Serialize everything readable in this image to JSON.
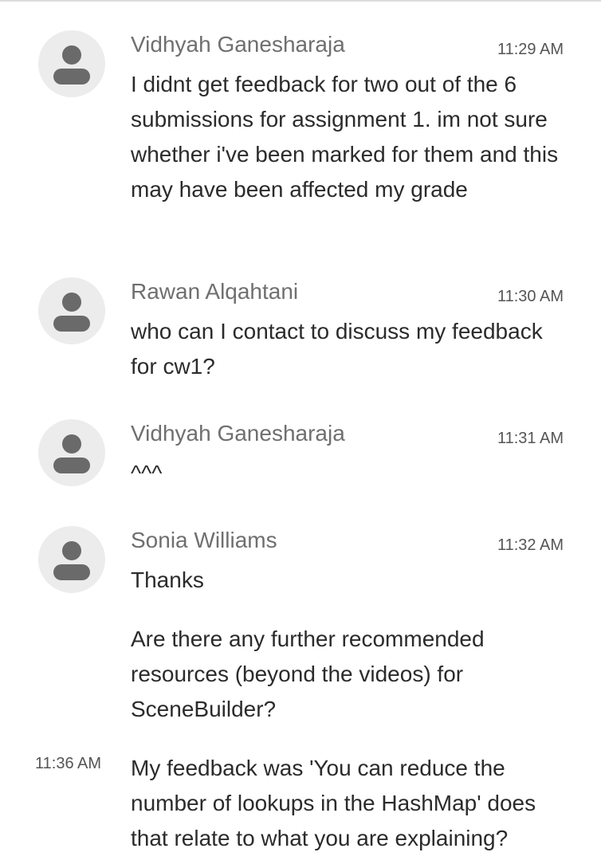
{
  "messages": [
    {
      "sender": "Vidhyah Ganesharaja",
      "time": "11:29 AM",
      "text": "I didnt get feedback for two out of the 6 submissions for assignment 1. im not sure whether i've been marked for them and this may have been affected my grade"
    },
    {
      "sender": "Rawan Alqahtani",
      "time": "11:30 AM",
      "text": "who can I contact to discuss my feedback for cw1?"
    },
    {
      "sender": "Vidhyah Ganesharaja",
      "time": "11:31 AM",
      "text": "^^^"
    },
    {
      "sender": "Sonia Williams",
      "time": "11:32 AM",
      "text": "Thanks",
      "followups": [
        {
          "text": "Are there any further recommended resources (beyond the videos) for SceneBuilder?"
        },
        {
          "time": "11:36 AM",
          "text": "My feedback was 'You can reduce the number of lookups in the HashMap' does that relate to what you are explaining?"
        }
      ]
    }
  ],
  "icons": {
    "avatar": "user-silhouette-icon"
  },
  "colors": {
    "avatar_bg": "#ececec",
    "avatar_glyph": "#6a6a6a",
    "sender": "#6f6f6f",
    "body": "#2b2b2b",
    "time": "#555555"
  }
}
